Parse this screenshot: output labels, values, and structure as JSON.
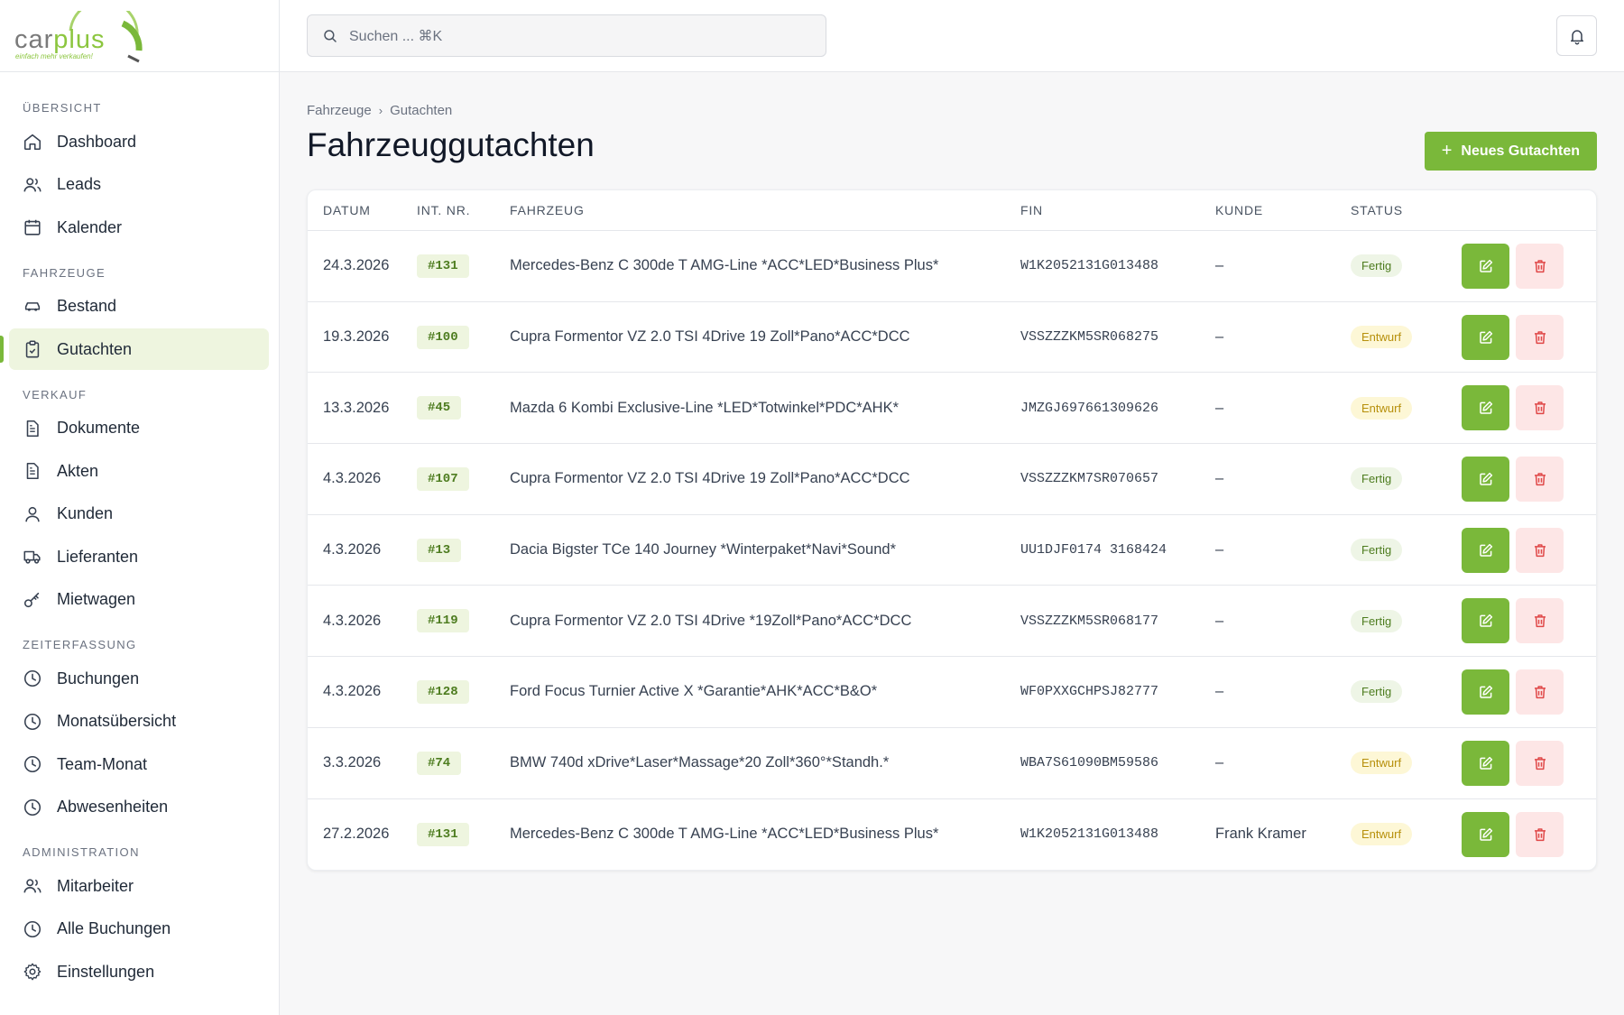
{
  "brand": {
    "logo_main": "car",
    "logo_accent": "plus",
    "tagline": "einfach mehr verkaufen!"
  },
  "search": {
    "placeholder": "Suchen ... ⌘K"
  },
  "sidebar": {
    "sections": [
      {
        "title": "ÜBERSICHT",
        "items": [
          {
            "label": "Dashboard",
            "icon": "home-icon"
          },
          {
            "label": "Leads",
            "icon": "users-icon"
          },
          {
            "label": "Kalender",
            "icon": "calendar-icon"
          }
        ]
      },
      {
        "title": "FAHRZEUGE",
        "items": [
          {
            "label": "Bestand",
            "icon": "car-icon"
          },
          {
            "label": "Gutachten",
            "icon": "clipboard-check-icon",
            "active": true
          }
        ]
      },
      {
        "title": "VERKAUF",
        "items": [
          {
            "label": "Dokumente",
            "icon": "document-icon"
          },
          {
            "label": "Akten",
            "icon": "document-icon"
          },
          {
            "label": "Kunden",
            "icon": "user-icon"
          },
          {
            "label": "Lieferanten",
            "icon": "truck-icon"
          },
          {
            "label": "Mietwagen",
            "icon": "key-icon"
          }
        ]
      },
      {
        "title": "ZEITERFASSUNG",
        "items": [
          {
            "label": "Buchungen",
            "icon": "clock-icon"
          },
          {
            "label": "Monatsübersicht",
            "icon": "clock-icon"
          },
          {
            "label": "Team-Monat",
            "icon": "clock-icon"
          },
          {
            "label": "Abwesenheiten",
            "icon": "clock-icon"
          }
        ]
      },
      {
        "title": "ADMINISTRATION",
        "items": [
          {
            "label": "Mitarbeiter",
            "icon": "users-icon"
          },
          {
            "label": "Alle Buchungen",
            "icon": "clock-icon"
          },
          {
            "label": "Einstellungen",
            "icon": "gear-icon"
          }
        ]
      }
    ]
  },
  "breadcrumb": [
    "Fahrzeuge",
    "Gutachten"
  ],
  "page": {
    "title": "Fahrzeuggutachten",
    "new_button": "Neues Gutachten"
  },
  "table": {
    "columns": [
      "DATUM",
      "INT. NR.",
      "FAHRZEUG",
      "FIN",
      "KUNDE",
      "STATUS"
    ],
    "rows": [
      {
        "datum": "24.3.2026",
        "nr": "#131",
        "fahrzeug": "Mercedes-Benz C 300de T AMG-Line *ACC*LED*Business Plus*",
        "fin": "W1K2052131G013488",
        "kunde": "–",
        "status": "Fertig"
      },
      {
        "datum": "19.3.2026",
        "nr": "#100",
        "fahrzeug": "Cupra Formentor VZ 2.0 TSI 4Drive 19 Zoll*Pano*ACC*DCC",
        "fin": "VSSZZZKM5SR068275",
        "kunde": "–",
        "status": "Entwurf"
      },
      {
        "datum": "13.3.2026",
        "nr": "#45",
        "fahrzeug": "Mazda 6 Kombi Exclusive-Line *LED*Totwinkel*PDC*AHK*",
        "fin": "JMZGJ697661309626",
        "kunde": "–",
        "status": "Entwurf"
      },
      {
        "datum": "4.3.2026",
        "nr": "#107",
        "fahrzeug": "Cupra Formentor VZ 2.0 TSI 4Drive 19 Zoll*Pano*ACC*DCC",
        "fin": "VSSZZZKM7SR070657",
        "kunde": "–",
        "status": "Fertig"
      },
      {
        "datum": "4.3.2026",
        "nr": "#13",
        "fahrzeug": "Dacia Bigster TCe 140 Journey *Winterpaket*Navi*Sound*",
        "fin": "UU1DJF0174 3168424",
        "kunde": "–",
        "status": "Fertig"
      },
      {
        "datum": "4.3.2026",
        "nr": "#119",
        "fahrzeug": "Cupra Formentor VZ 2.0 TSI 4Drive *19Zoll*Pano*ACC*DCC",
        "fin": "VSSZZZKM5SR068177",
        "kunde": "–",
        "status": "Fertig"
      },
      {
        "datum": "4.3.2026",
        "nr": "#128",
        "fahrzeug": "Ford Focus Turnier Active X *Garantie*AHK*ACC*B&O*",
        "fin": "WF0PXXGCHPSJ82777",
        "kunde": "–",
        "status": "Fertig"
      },
      {
        "datum": "3.3.2026",
        "nr": "#74",
        "fahrzeug": "BMW 740d xDrive*Laser*Massage*20 Zoll*360°*Standh.*",
        "fin": "WBA7S61090BM59586",
        "kunde": "–",
        "status": "Entwurf"
      },
      {
        "datum": "27.2.2026",
        "nr": "#131",
        "fahrzeug": "Mercedes-Benz C 300de T AMG-Line *ACC*LED*Business Plus*",
        "fin": "W1K2052131G013488",
        "kunde": "Frank Kramer",
        "status": "Entwurf"
      }
    ]
  },
  "colors": {
    "accent": "#7ab83a",
    "accent_light": "#eef5df",
    "danger_light": "#fde6e6",
    "danger": "#e04848"
  }
}
